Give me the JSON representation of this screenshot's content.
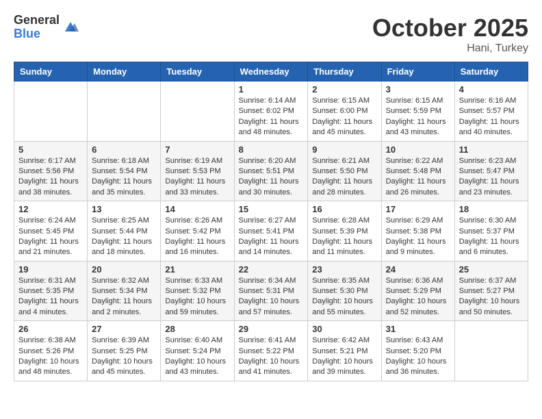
{
  "logo": {
    "general": "General",
    "blue": "Blue"
  },
  "header": {
    "month": "October 2025",
    "location": "Hani, Turkey"
  },
  "weekdays": [
    "Sunday",
    "Monday",
    "Tuesday",
    "Wednesday",
    "Thursday",
    "Friday",
    "Saturday"
  ],
  "weeks": [
    [
      {
        "day": "",
        "info": ""
      },
      {
        "day": "",
        "info": ""
      },
      {
        "day": "",
        "info": ""
      },
      {
        "day": "1",
        "info": "Sunrise: 6:14 AM\nSunset: 6:02 PM\nDaylight: 11 hours and 48 minutes."
      },
      {
        "day": "2",
        "info": "Sunrise: 6:15 AM\nSunset: 6:00 PM\nDaylight: 11 hours and 45 minutes."
      },
      {
        "day": "3",
        "info": "Sunrise: 6:15 AM\nSunset: 5:59 PM\nDaylight: 11 hours and 43 minutes."
      },
      {
        "day": "4",
        "info": "Sunrise: 6:16 AM\nSunset: 5:57 PM\nDaylight: 11 hours and 40 minutes."
      }
    ],
    [
      {
        "day": "5",
        "info": "Sunrise: 6:17 AM\nSunset: 5:56 PM\nDaylight: 11 hours and 38 minutes."
      },
      {
        "day": "6",
        "info": "Sunrise: 6:18 AM\nSunset: 5:54 PM\nDaylight: 11 hours and 35 minutes."
      },
      {
        "day": "7",
        "info": "Sunrise: 6:19 AM\nSunset: 5:53 PM\nDaylight: 11 hours and 33 minutes."
      },
      {
        "day": "8",
        "info": "Sunrise: 6:20 AM\nSunset: 5:51 PM\nDaylight: 11 hours and 30 minutes."
      },
      {
        "day": "9",
        "info": "Sunrise: 6:21 AM\nSunset: 5:50 PM\nDaylight: 11 hours and 28 minutes."
      },
      {
        "day": "10",
        "info": "Sunrise: 6:22 AM\nSunset: 5:48 PM\nDaylight: 11 hours and 26 minutes."
      },
      {
        "day": "11",
        "info": "Sunrise: 6:23 AM\nSunset: 5:47 PM\nDaylight: 11 hours and 23 minutes."
      }
    ],
    [
      {
        "day": "12",
        "info": "Sunrise: 6:24 AM\nSunset: 5:45 PM\nDaylight: 11 hours and 21 minutes."
      },
      {
        "day": "13",
        "info": "Sunrise: 6:25 AM\nSunset: 5:44 PM\nDaylight: 11 hours and 18 minutes."
      },
      {
        "day": "14",
        "info": "Sunrise: 6:26 AM\nSunset: 5:42 PM\nDaylight: 11 hours and 16 minutes."
      },
      {
        "day": "15",
        "info": "Sunrise: 6:27 AM\nSunset: 5:41 PM\nDaylight: 11 hours and 14 minutes."
      },
      {
        "day": "16",
        "info": "Sunrise: 6:28 AM\nSunset: 5:39 PM\nDaylight: 11 hours and 11 minutes."
      },
      {
        "day": "17",
        "info": "Sunrise: 6:29 AM\nSunset: 5:38 PM\nDaylight: 11 hours and 9 minutes."
      },
      {
        "day": "18",
        "info": "Sunrise: 6:30 AM\nSunset: 5:37 PM\nDaylight: 11 hours and 6 minutes."
      }
    ],
    [
      {
        "day": "19",
        "info": "Sunrise: 6:31 AM\nSunset: 5:35 PM\nDaylight: 11 hours and 4 minutes."
      },
      {
        "day": "20",
        "info": "Sunrise: 6:32 AM\nSunset: 5:34 PM\nDaylight: 11 hours and 2 minutes."
      },
      {
        "day": "21",
        "info": "Sunrise: 6:33 AM\nSunset: 5:32 PM\nDaylight: 10 hours and 59 minutes."
      },
      {
        "day": "22",
        "info": "Sunrise: 6:34 AM\nSunset: 5:31 PM\nDaylight: 10 hours and 57 minutes."
      },
      {
        "day": "23",
        "info": "Sunrise: 6:35 AM\nSunset: 5:30 PM\nDaylight: 10 hours and 55 minutes."
      },
      {
        "day": "24",
        "info": "Sunrise: 6:36 AM\nSunset: 5:29 PM\nDaylight: 10 hours and 52 minutes."
      },
      {
        "day": "25",
        "info": "Sunrise: 6:37 AM\nSunset: 5:27 PM\nDaylight: 10 hours and 50 minutes."
      }
    ],
    [
      {
        "day": "26",
        "info": "Sunrise: 6:38 AM\nSunset: 5:26 PM\nDaylight: 10 hours and 48 minutes."
      },
      {
        "day": "27",
        "info": "Sunrise: 6:39 AM\nSunset: 5:25 PM\nDaylight: 10 hours and 45 minutes."
      },
      {
        "day": "28",
        "info": "Sunrise: 6:40 AM\nSunset: 5:24 PM\nDaylight: 10 hours and 43 minutes."
      },
      {
        "day": "29",
        "info": "Sunrise: 6:41 AM\nSunset: 5:22 PM\nDaylight: 10 hours and 41 minutes."
      },
      {
        "day": "30",
        "info": "Sunrise: 6:42 AM\nSunset: 5:21 PM\nDaylight: 10 hours and 39 minutes."
      },
      {
        "day": "31",
        "info": "Sunrise: 6:43 AM\nSunset: 5:20 PM\nDaylight: 10 hours and 36 minutes."
      },
      {
        "day": "",
        "info": ""
      }
    ]
  ]
}
